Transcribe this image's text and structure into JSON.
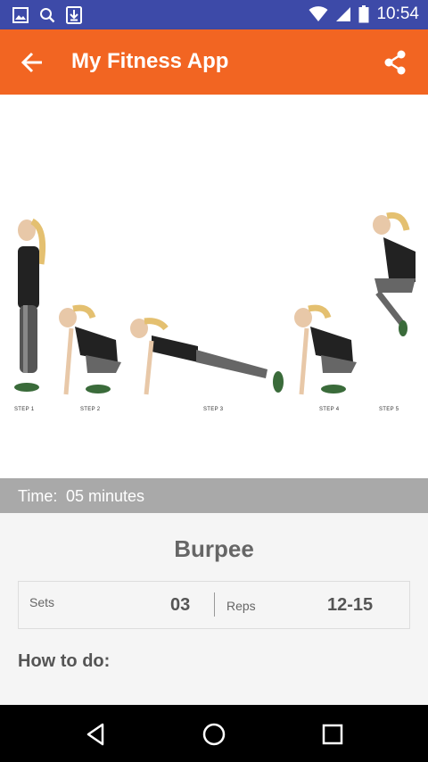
{
  "status_bar": {
    "time": "10:54",
    "icons": [
      "image-notification-icon",
      "search-notification-icon",
      "download-notification-icon",
      "wifi-icon",
      "cell-signal-icon",
      "battery-icon"
    ]
  },
  "app_bar": {
    "title": "My Fitness App",
    "back_icon": "arrow-back-icon",
    "share_icon": "share-icon",
    "color": "#f26522"
  },
  "hero": {
    "steps": [
      "STEP 1",
      "STEP 2",
      "STEP 3",
      "STEP 4",
      "STEP 5"
    ]
  },
  "time_bar": {
    "label": "Time:",
    "value": "05 minutes"
  },
  "exercise": {
    "name": "Burpee",
    "sets_label": "Sets",
    "sets_value": "03",
    "reps_label": "Reps",
    "reps_value": "12-15",
    "how_to_label": "How to do:"
  },
  "nav_bar": {
    "icons": [
      "back-triangle-icon",
      "home-circle-icon",
      "recents-square-icon"
    ]
  }
}
